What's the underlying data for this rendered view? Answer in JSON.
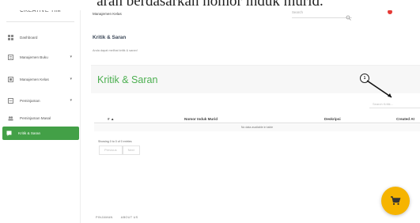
{
  "caption_fragment": "aran berdasarkan nomor induk murid.",
  "brand": "CREATIVE TIM",
  "sidebar": {
    "items": [
      {
        "label": "Dashboard",
        "icon": "dashboard-icon",
        "caret": ""
      },
      {
        "label": "Manajemen Buku",
        "icon": "book-icon",
        "caret": "▾"
      },
      {
        "label": "Manajemen Kelas",
        "icon": "class-icon",
        "caret": "▾"
      },
      {
        "label": "Peminjaman",
        "icon": "loan-icon",
        "caret": "▾"
      },
      {
        "label": "Peminjaman Masal",
        "icon": "group-icon",
        "caret": ""
      },
      {
        "label": "Kritik & Saran",
        "icon": "feedback-icon",
        "caret": ""
      }
    ],
    "active_color": "#43a047"
  },
  "topbar": {
    "title": "Manajemen Kelas",
    "search_placeholder": "Search"
  },
  "page": {
    "title": "Kritik & Saran",
    "subtitle": "Anda dapat melihat kritik & saran!"
  },
  "card": {
    "title": "Kritik & Saran",
    "title_color": "#4caf50",
    "table_search_placeholder": "Search Kritik...",
    "annotation_number": "1",
    "columns": [
      "# ▲",
      "Nomor Induk Murid",
      "Deskripsi",
      "Created At"
    ],
    "empty_message": "No data available in table",
    "info": "Showing 0 to 0 of 0 entries",
    "pager": {
      "previous": "Previous",
      "next": "Next"
    }
  },
  "footer": {
    "links": [
      "PINJAMAN",
      "ABOUT US"
    ]
  },
  "fab": {
    "icon": "cart-icon",
    "color": "#f6b400"
  }
}
